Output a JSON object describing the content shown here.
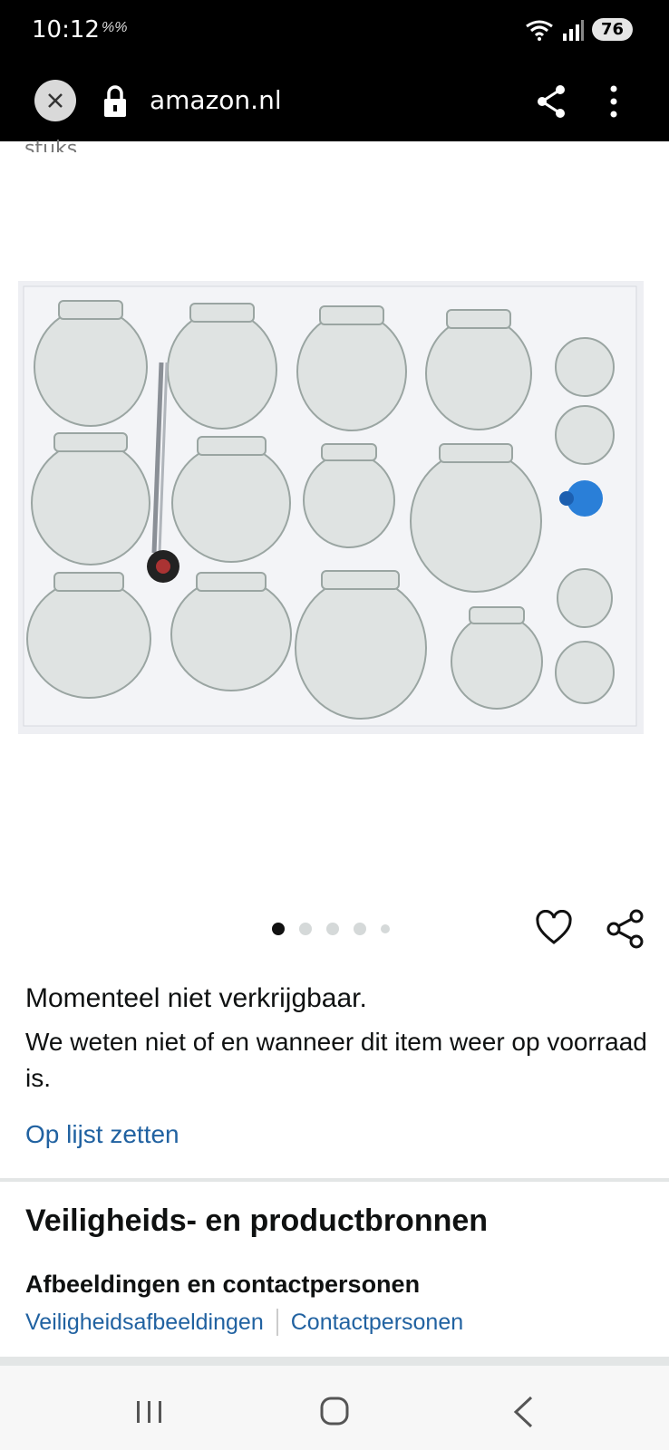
{
  "status_bar": {
    "time": "10:12",
    "extra": "%%",
    "battery": "76"
  },
  "browser": {
    "url": "amazon.nl",
    "icons": [
      "close-icon",
      "lock-icon",
      "share-icon",
      "more-vertical-icon"
    ]
  },
  "partial_text": "stuks",
  "product": {
    "image_alt": "glass-cupping-jars-set",
    "carousel_count": 5,
    "carousel_active": 1
  },
  "availability": {
    "title": "Momenteel niet verkrijgbaar.",
    "description": "We weten niet of en wanneer dit item weer op voorraad is."
  },
  "add_to_list": "Op lijst zetten",
  "safety": {
    "title": "Veiligheids- en productbronnen",
    "subtitle": "Afbeeldingen en contactpersonen",
    "link_images": "Veiligheidsafbeeldingen",
    "link_contacts": "Contactpersonen"
  },
  "colors": {
    "link": "#2162a1",
    "text": "#0f1111",
    "divider": "#e3e6e6"
  }
}
